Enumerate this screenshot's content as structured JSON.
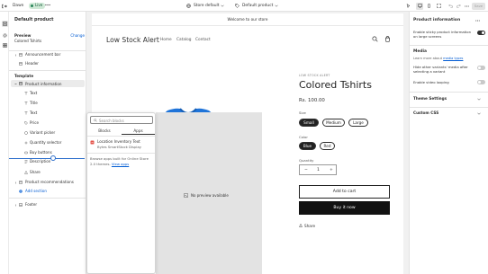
{
  "topbar": {
    "theme_name": "Dawn",
    "live_badge": "Live",
    "store_selector": "Store default",
    "template_selector": "Default product",
    "save_label": "Save"
  },
  "sidebar": {
    "title": "Default product",
    "preview_label": "Preview",
    "preview_value": "Colored Tshirts",
    "change_link": "Change",
    "header_items": [
      {
        "label": "Announcement bar"
      },
      {
        "label": "Header"
      }
    ],
    "template_heading": "Template",
    "product_information": "Product information",
    "blocks": [
      {
        "label": "Text"
      },
      {
        "label": "Title"
      },
      {
        "label": "Text"
      },
      {
        "label": "Price"
      },
      {
        "label": "Variant picker"
      },
      {
        "label": "Quantity selector"
      },
      {
        "label": "Buy buttons"
      },
      {
        "label": "Description"
      },
      {
        "label": "Share"
      }
    ],
    "product_recommendations": "Product recommendations",
    "add_section": "Add section",
    "footer": "Footer"
  },
  "store": {
    "announcement": "Welcome to our store",
    "logo": "Low Stock Alert",
    "nav": [
      "Home",
      "Catalog",
      "Contact"
    ],
    "vendor": "LOW STOCK ALERT",
    "product_title": "Colored Tshirts",
    "price": "Rs. 100.00",
    "size_label": "Size",
    "sizes": [
      "Small",
      "Medium",
      "Large"
    ],
    "color_label": "Color",
    "colors": [
      "Blue",
      "Red"
    ],
    "quantity_label": "Quantity",
    "quantity_minus": "−",
    "quantity_value": "1",
    "quantity_plus": "+",
    "add_to_cart": "Add to cart",
    "buy_now": "Buy it now",
    "share": "Share",
    "no_preview": "No preview available"
  },
  "picker": {
    "search_placeholder": "Search blocks",
    "tabs": [
      "Blocks",
      "Apps"
    ],
    "app_name": "Location Inventory Text",
    "app_vendor": "Bytes SmartStock Display",
    "note": "Browse apps built for Online Store 2.0 themes.",
    "note_link": "View apps"
  },
  "rpanel": {
    "title": "Product information",
    "sticky_label": "Enable sticky product information on large screens",
    "sticky_on": true,
    "media_heading": "Media",
    "media_note": "Learn more about",
    "media_link": "media types",
    "hide_variants_label": "Hide other variants' media after selecting a variant",
    "hide_variants_on": false,
    "video_loop_label": "Enable video looping",
    "video_loop_on": false,
    "theme_settings": "Theme Settings",
    "custom_css": "Custom CSS"
  },
  "colors": {
    "tshirt": "#1f74d9",
    "toggle_on": "#303030",
    "toggle_off": "#c9c9c9",
    "slider_handle": "#2c6ecb"
  }
}
